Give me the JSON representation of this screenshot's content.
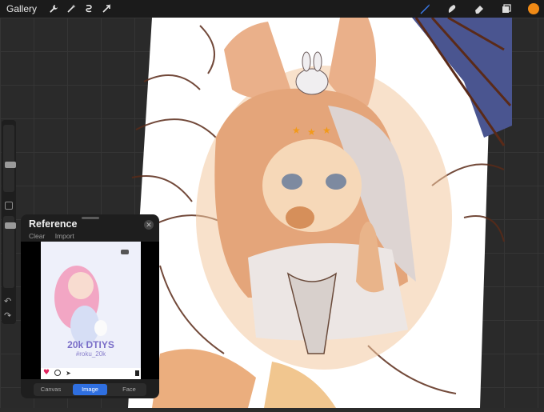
{
  "app": {
    "gallery_label": "Gallery",
    "accent_color": "#f08a16",
    "active_tool_color": "#3b7cf0"
  },
  "toolbar": {
    "left_icons": [
      "wrench-icon",
      "magic-wand-icon",
      "selection-icon",
      "transform-arrow-icon"
    ],
    "right_icons": [
      "brush-icon",
      "smudge-icon",
      "eraser-icon",
      "layers-icon"
    ],
    "current_color": "#f08a16"
  },
  "reference_panel": {
    "title": "Reference",
    "clear_label": "Clear",
    "import_label": "Import",
    "tabs": [
      {
        "label": "Canvas",
        "active": false
      },
      {
        "label": "Image",
        "active": true
      },
      {
        "label": "Face",
        "active": false
      }
    ],
    "image_caption": "20k DTIYS",
    "image_tag": "#roku_20k"
  }
}
